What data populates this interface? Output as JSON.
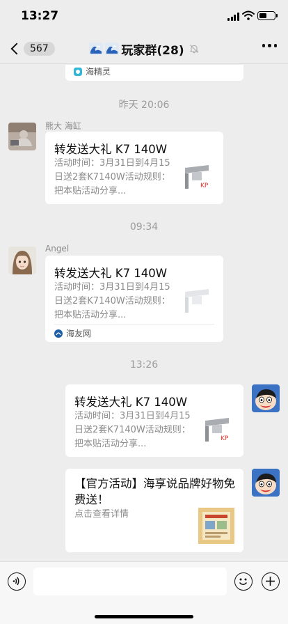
{
  "status_bar": {
    "time": "13:27"
  },
  "nav": {
    "unread_count": "567",
    "title": "玩家群(28)",
    "title_icons": [
      "wave-icon",
      "wave-icon"
    ],
    "muted": true
  },
  "chat": {
    "partial_card_source": "海精灵",
    "timestamps": [
      "昨天 20:06",
      "09:34",
      "13:26"
    ],
    "messages": [
      {
        "sender": "熊大 海缸",
        "title": "转发送大礼 K7 140W",
        "desc": "活动时间：3月31日到4月15日送2套K7140W活动规则：把本贴活动分享...",
        "thumb_tag": "KP"
      },
      {
        "sender": "Angel",
        "title": "转发送大礼 K7 140W",
        "desc": "活动时间：3月31日到4月15日送2套K7140W活动规则：把本贴活动分享...",
        "source": "海友网"
      },
      {
        "sender": "",
        "title": "转发送大礼 K7 140W",
        "desc": "活动时间：3月31日到4月15日送2套K7140W活动规则：把本贴活动分享...",
        "thumb_tag": "KP"
      },
      {
        "sender": "",
        "title": "【官方活动】海享说品牌好物免费送！",
        "desc": "点击查看详情"
      }
    ]
  },
  "colors": {
    "background": "#ededed",
    "bubble": "#ffffff",
    "timestamp": "#9b9b9b",
    "secondary_text": "#8a8a8a"
  },
  "input_bar": {
    "icons": [
      "voice-icon",
      "emoji-icon",
      "plus-icon"
    ]
  }
}
